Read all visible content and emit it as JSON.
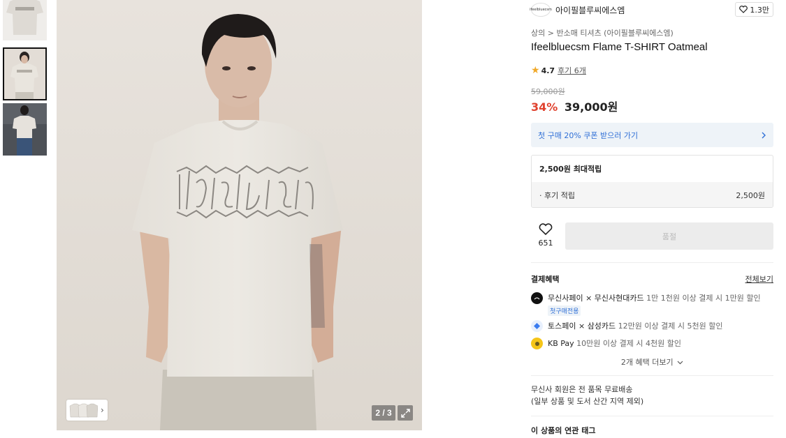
{
  "brand": {
    "logo_text": "ifeelbluecsm",
    "name": "아이필블루씨에스엠",
    "like_count": "1.3만"
  },
  "breadcrumb": {
    "category": "상의",
    "separator": ">",
    "subcategory": "반소매 티셔츠 (아이필블루씨에스엠)"
  },
  "product": {
    "title": "Ifeelbluecsm Flame T-SHIRT Oatmeal",
    "rating": "4.7",
    "reviews_label": "후기 6개",
    "original_price": "59,000원",
    "discount": "34%",
    "price": "39,000원"
  },
  "coupon": {
    "label": "첫 구매 20% 쿠폰 받으러 가기"
  },
  "points": {
    "max_label": "2,500원 최대적립",
    "row_label": "· 후기 적립",
    "row_value": "2,500원"
  },
  "actions": {
    "wish_count": "651",
    "buy_label": "품절"
  },
  "gallery": {
    "counter": "2 / 3",
    "chevron": "›"
  },
  "benefits": {
    "title": "결제혜택",
    "see_all": "전체보기",
    "items": [
      {
        "brand": "무신사페이 × 무신사현대카드",
        "desc": "1만 1천원 이상 결제 시 1만원 할인",
        "tag": "첫구매전용",
        "color": "#111111"
      },
      {
        "brand": "토스페이 × 삼성카드",
        "desc": "12만원 이상 결제 시 5천원 할인",
        "tag": "",
        "color": "#3a7cf0"
      },
      {
        "brand": "KB Pay",
        "desc": "10만원 이상 결제 시 4천원 할인",
        "tag": "",
        "color": "#f5c518"
      }
    ],
    "more_label": "2개 혜택 더보기"
  },
  "shipping": {
    "line1": "무신사 회원은 전 품목 무료배송",
    "line2": "(일부 상품 및 도서 산간 지역 제외)"
  },
  "tags": {
    "title": "이 상품의 연관 태그"
  },
  "colors": {
    "discount": "#e0422f",
    "coupon_text": "#2f6fd6",
    "coupon_bg": "#eef3f8",
    "star": "#f0a92a"
  }
}
